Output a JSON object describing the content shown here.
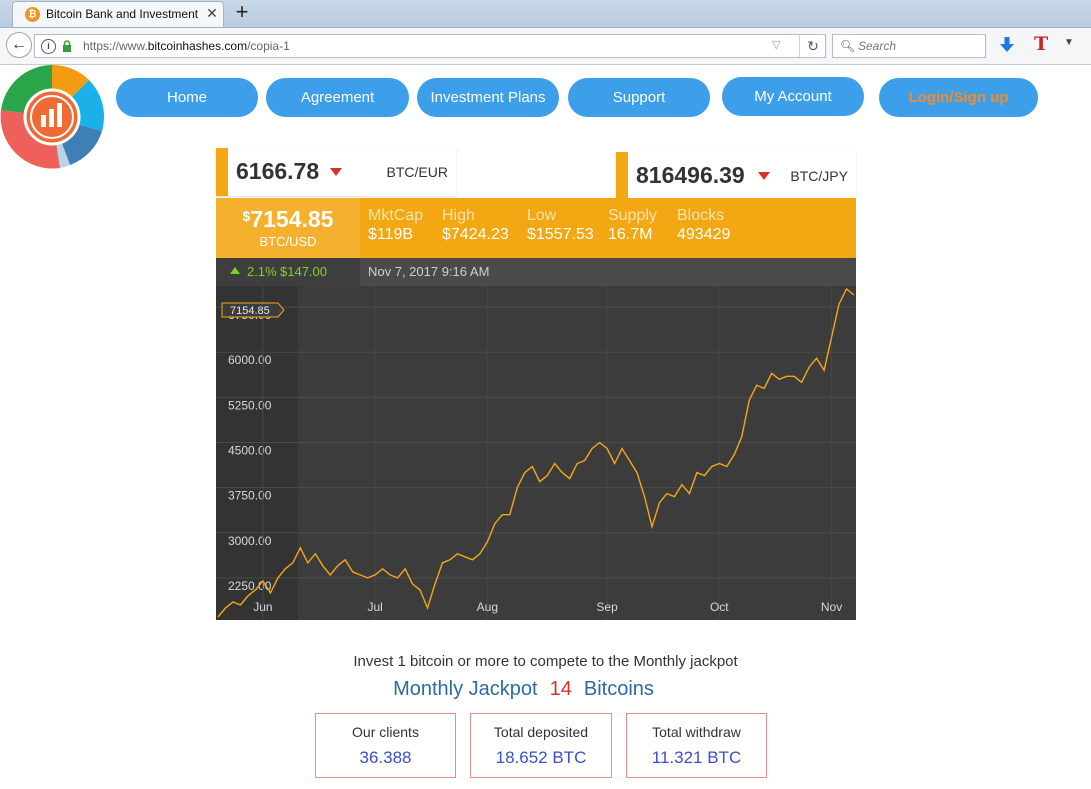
{
  "browser": {
    "tab_title": "Bitcoin Bank and Investment",
    "tab_favicon": "₿",
    "url_prefix": "https://www.",
    "url_host": "bitcoinhashes.com",
    "url_path": "/copia-1",
    "search_placeholder": "Search"
  },
  "nav": {
    "home": "Home",
    "agreement": "Agreement",
    "plans": "Investment Plans",
    "support": "Support",
    "account": "My Account",
    "login": "Login/Sign up"
  },
  "ticker": {
    "eur": {
      "value": "6166.78",
      "pair": "BTC/EUR"
    },
    "jpy": {
      "value": "816496.39",
      "pair": "BTC/JPY"
    },
    "usd": {
      "currency": "$",
      "value": "7154.85",
      "pair": "BTC/USD"
    },
    "stats": [
      {
        "label": "MktCap",
        "value": "$119B"
      },
      {
        "label": "High",
        "value": "$7424.23"
      },
      {
        "label": "Low",
        "value": "$1557.53"
      },
      {
        "label": "Supply",
        "value": "16.7M"
      },
      {
        "label": "Blocks",
        "value": "493429"
      }
    ],
    "change_pct": "2.1%",
    "change_abs": "$147.00",
    "timestamp": "Nov 7, 2017 9:16 AM"
  },
  "colors": {
    "accent_orange": "#f3a712",
    "nav_blue": "#3d9eea",
    "login_orange": "#f58b2a",
    "up_green": "#7ed321",
    "down_red": "#d9302c"
  },
  "chart_data": {
    "type": "line",
    "title": "",
    "xlabel": "",
    "ylabel": "",
    "x_ticks": [
      "Jun",
      "Jul",
      "Aug",
      "Sep",
      "Oct",
      "Nov"
    ],
    "y_ticks": [
      2250,
      3000,
      3750,
      4500,
      5250,
      6000,
      6750
    ],
    "y_tick_labels": [
      "2250.00",
      "3000.00",
      "3750.00",
      "4500.00",
      "5250.00",
      "6000.00",
      "6750.00"
    ],
    "current_label": "7154.85",
    "ylim": [
      1750,
      7300
    ],
    "grid": true,
    "series": [
      {
        "x": [
          "May 21",
          "May 23",
          "May 25",
          "May 27",
          "May 29",
          "May 31",
          "Jun 2",
          "Jun 4",
          "Jun 6",
          "Jun 8",
          "Jun 10",
          "Jun 12",
          "Jun 14",
          "Jun 16",
          "Jun 18",
          "Jun 20",
          "Jun 22",
          "Jun 24",
          "Jun 26",
          "Jun 28",
          "Jun 30",
          "Jul 2",
          "Jul 4",
          "Jul 6",
          "Jul 8",
          "Jul 10",
          "Jul 12",
          "Jul 14",
          "Jul 16",
          "Jul 18",
          "Jul 20",
          "Jul 22",
          "Jul 24",
          "Jul 26",
          "Jul 28",
          "Jul 30",
          "Aug 1",
          "Aug 3",
          "Aug 5",
          "Aug 7",
          "Aug 9",
          "Aug 11",
          "Aug 13",
          "Aug 15",
          "Aug 17",
          "Aug 19",
          "Aug 21",
          "Aug 23",
          "Aug 25",
          "Aug 27",
          "Aug 29",
          "Aug 31",
          "Sep 2",
          "Sep 4",
          "Sep 6",
          "Sep 8",
          "Sep 10",
          "Sep 12",
          "Sep 14",
          "Sep 16",
          "Sep 18",
          "Sep 20",
          "Sep 22",
          "Sep 24",
          "Sep 26",
          "Sep 28",
          "Sep 30",
          "Oct 2",
          "Oct 4",
          "Oct 6",
          "Oct 8",
          "Oct 10",
          "Oct 12",
          "Oct 14",
          "Oct 16",
          "Oct 18",
          "Oct 20",
          "Oct 22",
          "Oct 24",
          "Oct 26",
          "Oct 28",
          "Oct 30",
          "Nov 1",
          "Nov 3",
          "Nov 5",
          "Nov 7"
        ],
        "y": [
          1800,
          1950,
          2050,
          2000,
          2150,
          2250,
          2400,
          2200,
          2450,
          2600,
          2700,
          2950,
          2700,
          2850,
          2650,
          2500,
          2650,
          2750,
          2550,
          2500,
          2450,
          2500,
          2600,
          2500,
          2450,
          2600,
          2350,
          2250,
          1950,
          2350,
          2700,
          2750,
          2850,
          2800,
          2750,
          2850,
          3050,
          3350,
          3500,
          3500,
          3950,
          4200,
          4300,
          4050,
          4150,
          4350,
          4200,
          4100,
          4350,
          4400,
          4600,
          4700,
          4600,
          4350,
          4600,
          4400,
          4200,
          3800,
          3300,
          3700,
          3850,
          3800,
          4000,
          3850,
          4200,
          4150,
          4300,
          4350,
          4300,
          4500,
          4800,
          5400,
          5650,
          5600,
          5850,
          5750,
          5800,
          5800,
          5700,
          5950,
          6100,
          5900,
          6450,
          7000,
          7250,
          7150
        ]
      }
    ]
  },
  "jackpot": {
    "invite": "Invest 1 bitcoin or more to compete to the Monthly jackpot",
    "label": "Monthly Jackpot",
    "amount": "14",
    "unit": "Bitcoins"
  },
  "stat_boxes": [
    {
      "title": "Our clients",
      "value": "36.388"
    },
    {
      "title": "Total deposited",
      "value": "18.652 BTC"
    },
    {
      "title": "Total withdraw",
      "value": "11.321 BTC"
    }
  ]
}
